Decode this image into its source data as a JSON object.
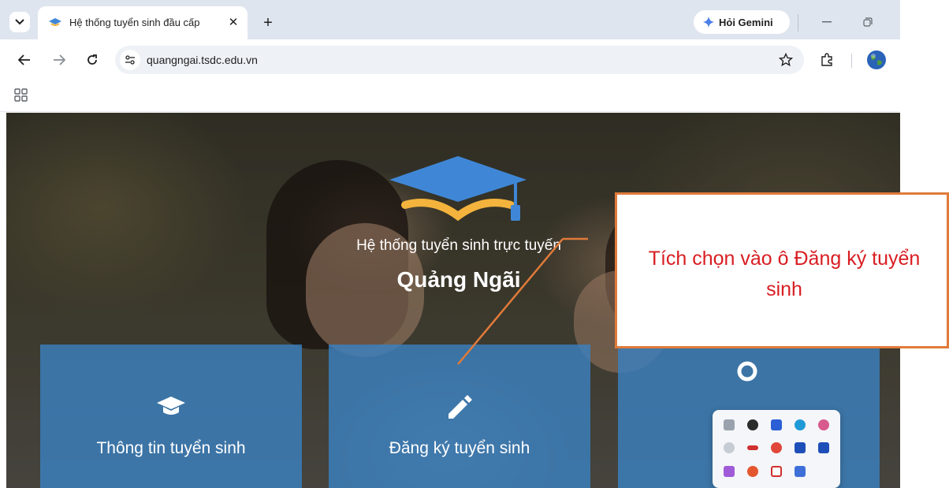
{
  "browser": {
    "tab_title": "Hệ thống tuyển sinh đầu cấp",
    "tab_close_glyph": "✕",
    "new_tab_glyph": "+",
    "gemini_label": "Hỏi Gemini",
    "url": "quangngai.tsdc.edu.vn"
  },
  "page": {
    "subtitle": "Hệ thống tuyển sinh trực tuyến",
    "title": "Quảng Ngãi",
    "cards": [
      {
        "label": "Thông tin tuyển sinh",
        "icon": "graduation-cap-icon"
      },
      {
        "label": "Đăng ký tuyển sinh",
        "icon": "pencil-icon"
      },
      {
        "label": "",
        "icon": "search-icon"
      }
    ]
  },
  "annotation": {
    "text": "Tích chọn vào ô Đăng ký tuyển sinh"
  },
  "colors": {
    "card_blue": "#3a80be",
    "callout_border": "#e07b3a",
    "callout_text": "#d81d22",
    "logo_blue": "#3f87d6",
    "logo_gold": "#f3b33d"
  },
  "icons": {
    "tab_strip": [
      "tab-search-chevron-icon",
      "site-favicon-icon"
    ],
    "toolbar": [
      "back-arrow-icon",
      "forward-arrow-icon",
      "reload-icon",
      "site-settings-icon",
      "bookmark-star-icon",
      "extensions-icon",
      "profile-globe-icon"
    ],
    "tray": [
      "app-icon",
      "chatgpt-icon",
      "arrow-app-icon",
      "edge-icon",
      "copilot-icon",
      "cloud-icon",
      "red-app-icon",
      "chrome-icon",
      "blue-arrow-icon",
      "blue-arrow-icon",
      "pen-icon",
      "firefox-icon",
      "vivaldi-icon",
      "shield-icon"
    ]
  }
}
